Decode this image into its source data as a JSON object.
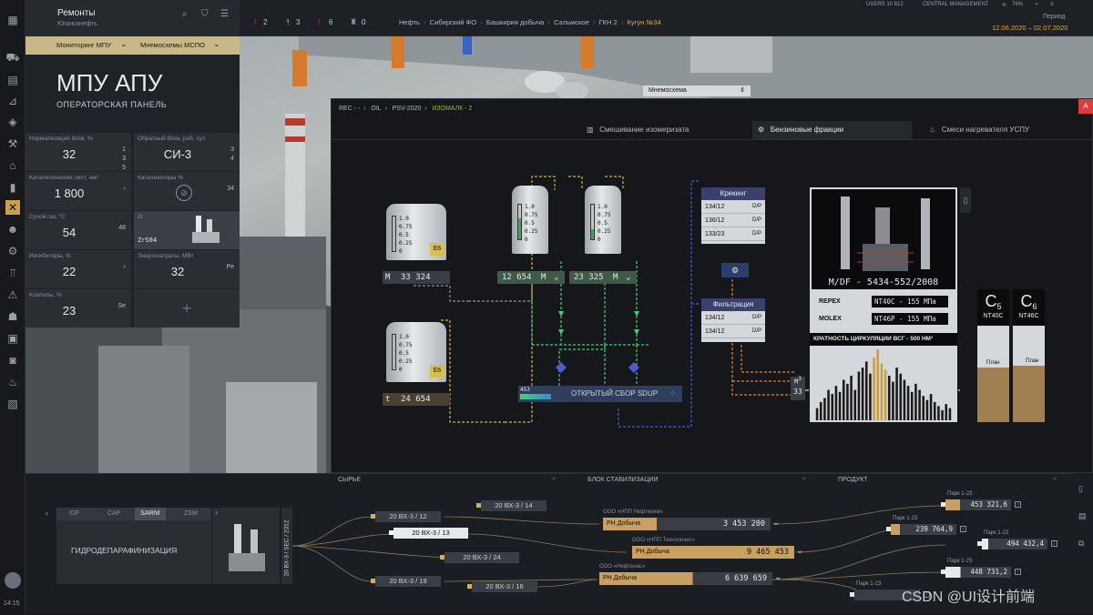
{
  "app": {
    "title": "Ремонты",
    "org": "Юганскнефть",
    "time": "14:15"
  },
  "topbar": {
    "alerts": [
      {
        "icon": "alert-red",
        "count": "2"
      },
      {
        "icon": "alert-white",
        "count": "3"
      },
      {
        "icon": "alert-red",
        "count": "6"
      },
      {
        "icon": "lock-icon",
        "count": "0"
      }
    ],
    "breadcrumb": [
      "Нефть",
      "Сибирский ФО",
      "Башкирия добыча",
      "Сальмское",
      "ГКН 2",
      "Кугун №34"
    ],
    "users": "USERS 10 812",
    "central": "CENTRAL MANAGEMENT",
    "battery": "76%",
    "period_label": "Период",
    "period": "12.06.2020 – 02.07.2020"
  },
  "panel": {
    "tab1": "Мониторинг МПУ",
    "tab2": "Мнемосхемы МСПО",
    "title": "МПУ АПУ",
    "subtitle": "ОПЕРАТОРСКАЯ ПАНЕЛЬ",
    "kpis": [
      {
        "label": "Нормализация блок, %",
        "value": "32",
        "side": "1\n3\n5"
      },
      {
        "label": "Обратный блок, раб. сут.",
        "value": "СИ-3",
        "side": "3\n4"
      },
      {
        "label": "Каталитических сист, нм³",
        "value": "1 800",
        "side": "›"
      },
      {
        "label": "Катализаторы %",
        "value": "",
        "side": "34"
      },
      {
        "label": "Сухой газ, °С",
        "value": "54",
        "side": "48"
      },
      {
        "label": "Zr",
        "value": "ZrS04",
        "side": ""
      },
      {
        "label": "Ингибиторы, %",
        "value": "22",
        "side": "›"
      },
      {
        "label": "Энергозатраты, МВт",
        "value": "32",
        "side": "Pe"
      },
      {
        "label": "Ксилолы, %",
        "value": "23",
        "side": "Se"
      }
    ],
    "add": "+"
  },
  "dropdown": {
    "label": "Мнемосхема"
  },
  "mnemo": {
    "crumbs": [
      "REC - -",
      "OIL",
      "PSV-2020",
      "ИЗОМАЛК - 2"
    ],
    "alarm": "A",
    "tabs": [
      "Смешивание изомеризата",
      "Бензиновые фракции",
      "Смеси нагревателя УСПУ"
    ],
    "scale": [
      "1.0",
      "0.75",
      "0.5",
      "0.25",
      "0"
    ],
    "tank_tags": [
      "E6",
      "E6"
    ],
    "fields": [
      {
        "tag": "M",
        "val": "33 324"
      },
      {
        "tag": "t",
        "val": "24 654"
      },
      {
        "tag": "",
        "val": "12 654",
        "unit": "M"
      },
      {
        "tag": "",
        "val": "23 325",
        "unit": "M"
      }
    ],
    "collector": {
      "label": "ОТКРЫТЫЙ СБОР SDUP",
      "val": "453"
    },
    "cracking": {
      "title": "Крекинг",
      "rows": [
        "134/12",
        "136/12",
        "133/23"
      ]
    },
    "filtration": {
      "title": "Фильтрация",
      "rows": [
        "134/12",
        "134/12"
      ]
    },
    "photo_caption": "M/DF - 5434-552/2008",
    "repex": {
      "label": "REPEX",
      "val": "NT40C - 155 МПа"
    },
    "molex": {
      "label": "MOLEX",
      "val": "NT46P - 155 МПа"
    },
    "ratio_title": "КРАТНОСТЬ ЦИРКУЛЯЦИИ ВСГ - 500 НМ³",
    "m_tag": "M",
    "m_val": "3",
    "n33": "33",
    "c5": {
      "sym": "C",
      "sub": "5",
      "tag": "NT40C",
      "plan": "План"
    },
    "c6": {
      "sym": "C",
      "sub": "6",
      "tag": "NT46C",
      "plan": "План"
    },
    "hist": [
      12,
      18,
      22,
      30,
      26,
      34,
      28,
      40,
      36,
      44,
      30,
      48,
      52,
      58,
      46,
      62,
      70,
      56,
      50,
      44,
      38,
      52,
      46,
      40,
      34,
      28,
      36,
      30,
      24,
      20,
      26,
      18,
      14,
      10,
      16,
      12
    ],
    "hist_gold": [
      15,
      16,
      17,
      18
    ]
  },
  "bottom": {
    "syr": "СЫРЬЕ",
    "stab": "БЛОК СТАБИЛИЗАЦИИ",
    "prod": "ПРОДУКТ",
    "tabs": [
      "IDF",
      "CAP",
      "SARNI",
      "ZSM"
    ],
    "active_tab": "SARNI",
    "unit": "ГИДРОДЕПАРАФИНИЗАЦИЯ",
    "vlabel": "20 ВХ-3 / SEC / 2312",
    "nodes": [
      "20 ВХ-3 / 14",
      "20 ВХ-3 / 12",
      "20 ВХ-3 / 13",
      "20 ВХ-3 / 24",
      "20 ВХ-3 / 19",
      "20 ВХ-3 / 16"
    ],
    "producers": [
      {
        "org": "ООО «НПП Нефтехим»",
        "label": "РН Добыча",
        "val": "3 453 200"
      },
      {
        "org": "ООО «НПП Технолизис»",
        "label": "РН Добыча",
        "val": "9 465 453"
      },
      {
        "org": "ООО «Нефтенас»",
        "label": "РН Добыча",
        "val": "6 639 659"
      }
    ],
    "parks": [
      {
        "label": "Парк 1-23",
        "val": "453 321,6"
      },
      {
        "label": "Парк 1-23",
        "val": "239 764,9"
      },
      {
        "label": "Парк 1-23",
        "val": "494 432,4"
      },
      {
        "label": "Парк 1-23",
        "val": "448 731,2"
      },
      {
        "label": "Парк 1-23",
        "val": ""
      }
    ]
  },
  "watermark": "CSDN @UI设计前端",
  "colors": {
    "gold": "#c8a04a",
    "blue": "#4d5ad8",
    "green": "#3fd17a",
    "orange": "#e0843a"
  }
}
